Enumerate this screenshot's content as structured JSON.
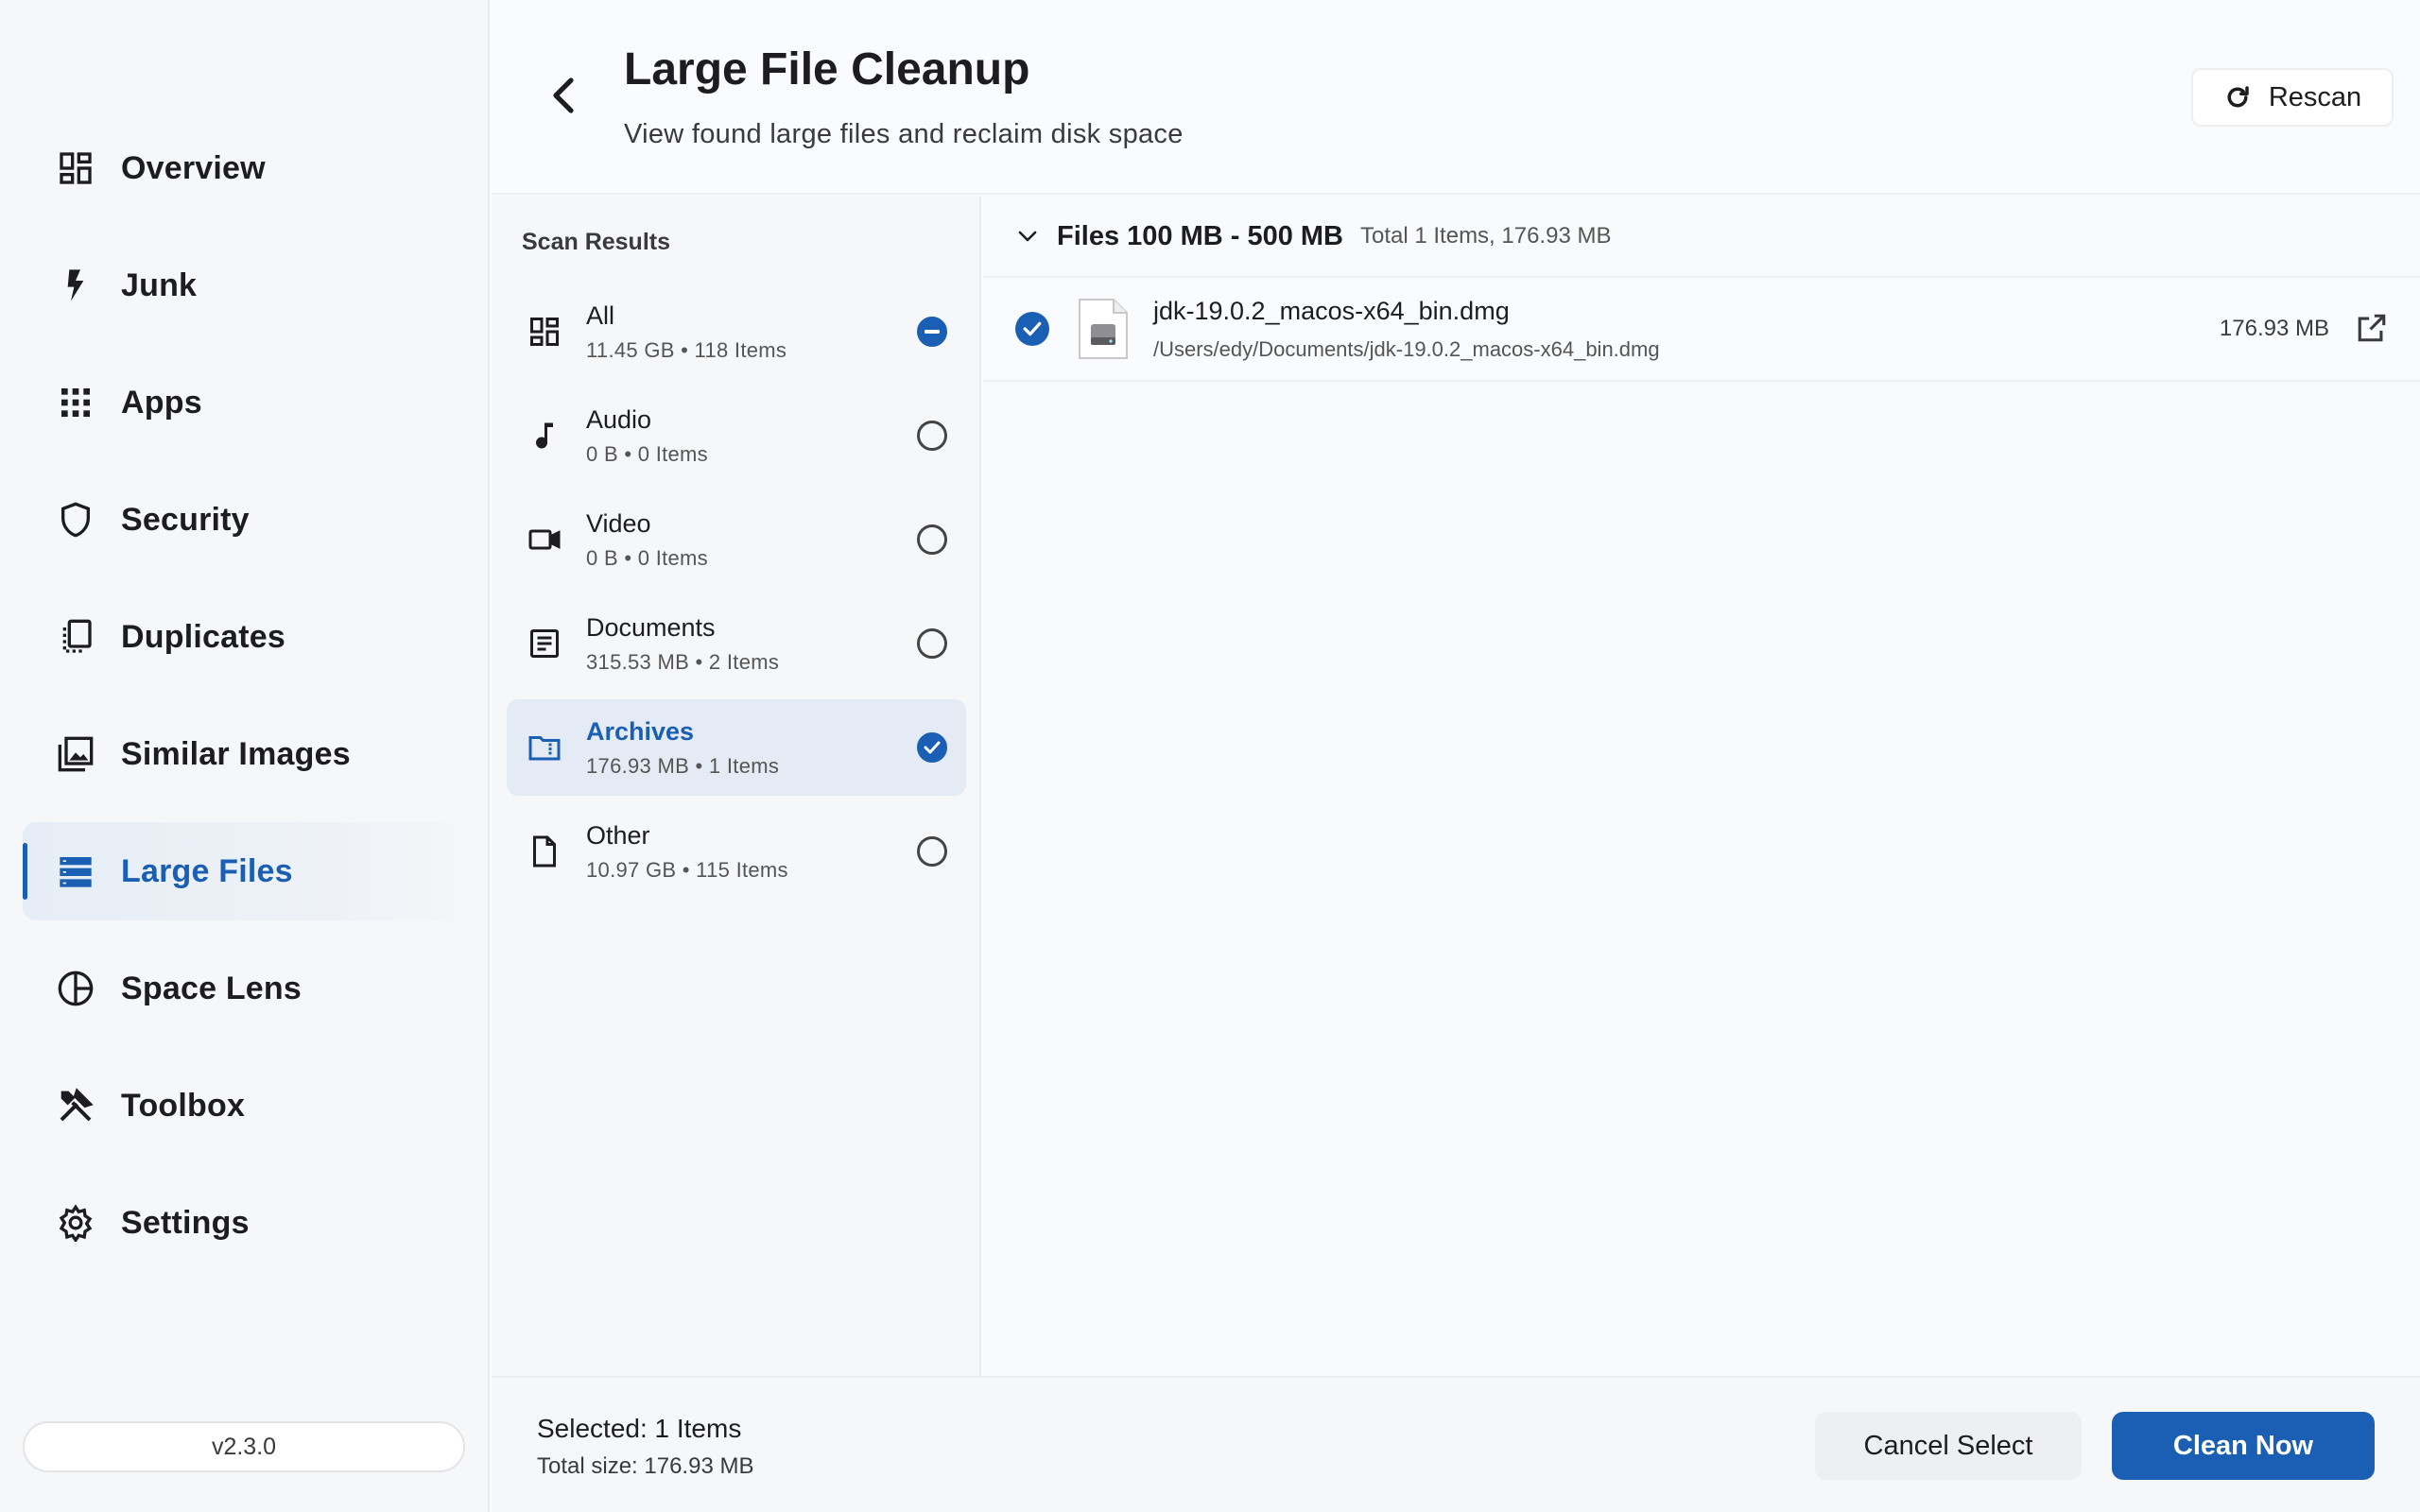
{
  "window": {
    "traffic_lights": [
      "close",
      "minimize",
      "zoom"
    ]
  },
  "sidebar": {
    "items": [
      {
        "label": "Overview",
        "icon": "dashboard-icon"
      },
      {
        "label": "Junk",
        "icon": "bolt-icon"
      },
      {
        "label": "Apps",
        "icon": "grid-icon"
      },
      {
        "label": "Security",
        "icon": "shield-icon"
      },
      {
        "label": "Duplicates",
        "icon": "duplicates-icon"
      },
      {
        "label": "Similar Images",
        "icon": "images-icon"
      },
      {
        "label": "Large Files",
        "icon": "storage-icon",
        "active": true
      },
      {
        "label": "Space Lens",
        "icon": "pie-icon"
      },
      {
        "label": "Toolbox",
        "icon": "tools-icon"
      },
      {
        "label": "Settings",
        "icon": "gear-icon"
      }
    ],
    "version": "v2.3.0"
  },
  "header": {
    "title": "Large File Cleanup",
    "subtitle": "View found large files and reclaim disk space",
    "rescan_label": "Rescan"
  },
  "scan_results": {
    "title": "Scan Results",
    "categories": [
      {
        "name": "All",
        "meta": "11.45 GB • 118 Items",
        "state": "partial",
        "icon": "dashboard-icon"
      },
      {
        "name": "Audio",
        "meta": "0 B • 0 Items",
        "state": "unchecked",
        "icon": "music-note-icon"
      },
      {
        "name": "Video",
        "meta": "0 B • 0 Items",
        "state": "unchecked",
        "icon": "video-camera-icon"
      },
      {
        "name": "Documents",
        "meta": "315.53 MB • 2 Items",
        "state": "unchecked",
        "icon": "document-icon"
      },
      {
        "name": "Archives",
        "meta": "176.93 MB • 1 Items",
        "state": "checked",
        "icon": "archive-folder-icon",
        "selected": true
      },
      {
        "name": "Other",
        "meta": "10.97 GB • 115 Items",
        "state": "unchecked",
        "icon": "file-icon"
      }
    ]
  },
  "files": {
    "group_title": "Files 100 MB - 500 MB",
    "group_meta": "Total 1 Items, 176.93 MB",
    "items": [
      {
        "name": "jdk-19.0.2_macos-x64_bin.dmg",
        "path": "/Users/edy/Documents/jdk-19.0.2_macos-x64_bin.dmg",
        "size": "176.93 MB",
        "checked": true
      }
    ]
  },
  "footer": {
    "selected_label": "Selected: 1 Items",
    "total_label": "Total size: 176.93 MB",
    "cancel_label": "Cancel Select",
    "clean_label": "Clean Now"
  },
  "colors": {
    "accent": "#1a5fb4",
    "selected_bg": "#e4ebf4",
    "background": "#fafbfc"
  }
}
